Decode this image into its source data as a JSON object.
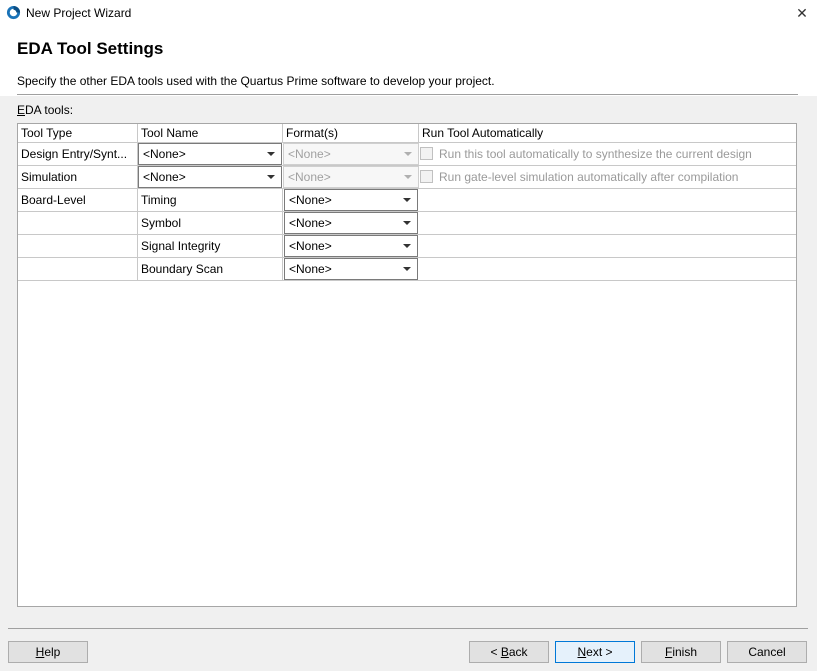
{
  "window": {
    "title": "New Project Wizard",
    "close_glyph": "✕"
  },
  "page": {
    "title": "EDA Tool Settings",
    "description": "Specify the other EDA tools used with the Quartus Prime software to develop your project.",
    "section_label_mnemonic": "E",
    "section_label_rest": "DA tools:"
  },
  "table": {
    "headers": [
      "Tool Type",
      "Tool Name",
      "Format(s)",
      "Run Tool Automatically"
    ],
    "rows": [
      {
        "type": "Design Entry/Synt...",
        "name_value": "<None>",
        "format_value": "<None>",
        "run_checked": false,
        "run_label": "Run this tool automatically to synthesize the current design"
      },
      {
        "type": "Simulation",
        "name_value": "<None>",
        "format_value": "<None>",
        "run_checked": false,
        "run_label": "Run gate-level simulation automatically after compilation"
      },
      {
        "type": "Board-Level",
        "name": "Timing",
        "format_value": "<None>"
      },
      {
        "type": "",
        "name": "Symbol",
        "format_value": "<None>"
      },
      {
        "type": "",
        "name": "Signal Integrity",
        "format_value": "<None>"
      },
      {
        "type": "",
        "name": "Boundary Scan",
        "format_value": "<None>"
      }
    ]
  },
  "footer": {
    "help": {
      "mnemonic": "H",
      "rest": "elp"
    },
    "back": {
      "prefix": "< ",
      "mnemonic": "B",
      "rest": "ack"
    },
    "next": {
      "mnemonic": "N",
      "rest": "ext >"
    },
    "finish": {
      "mnemonic": "F",
      "rest": "inish"
    },
    "cancel": "Cancel"
  },
  "colors": {
    "accent": "#0078d7",
    "background": "#f0f0f0",
    "header": "#ffffff"
  },
  "icons": {
    "app": "quartus-logo-icon",
    "close": "close-icon",
    "dropdown": "chevron-down-icon"
  }
}
